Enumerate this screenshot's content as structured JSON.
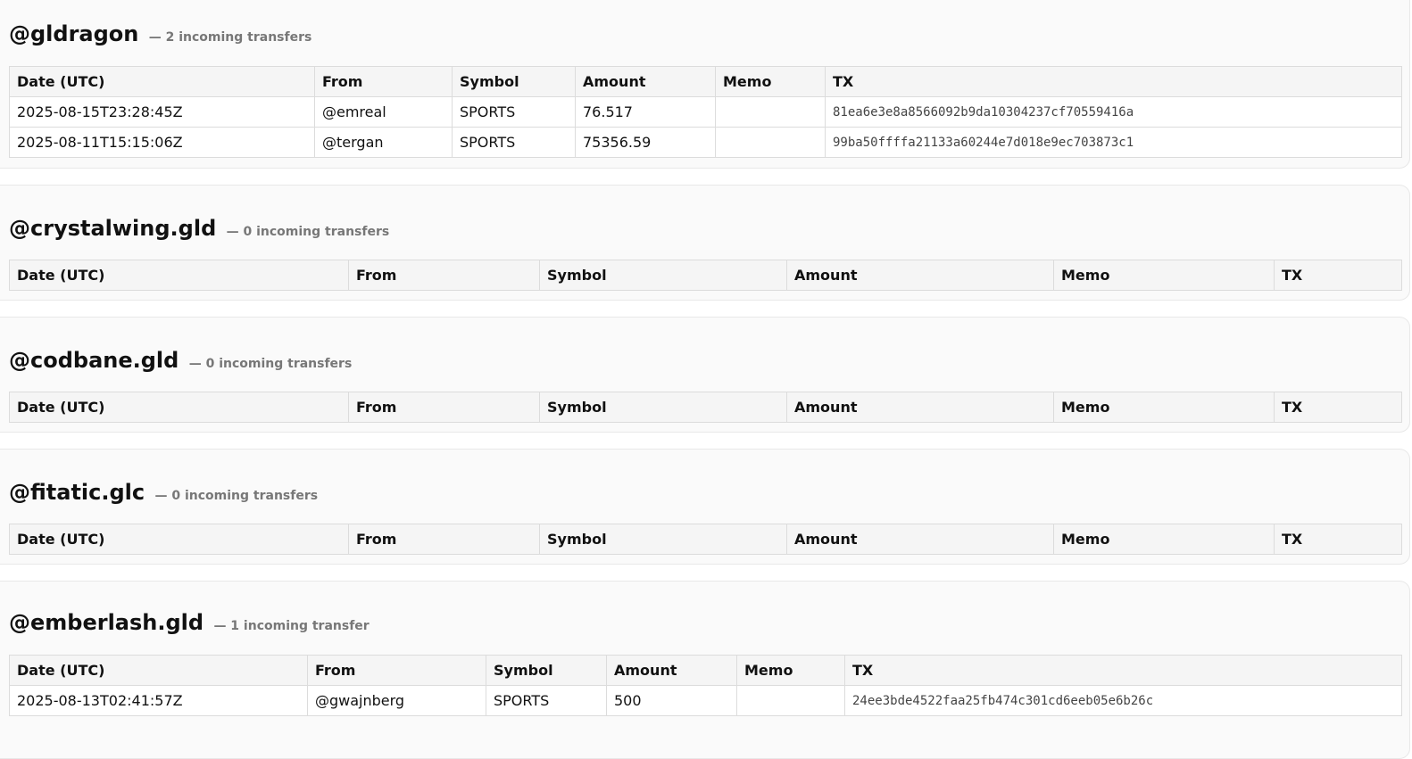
{
  "columns": [
    "Date (UTC)",
    "From",
    "Symbol",
    "Amount",
    "Memo",
    "TX"
  ],
  "accounts": [
    {
      "name": "@gldragon",
      "count_text": "— 2 incoming transfers",
      "rows": [
        {
          "date": "2025-08-15T23:28:45Z",
          "from": "@emreal",
          "symbol": "SPORTS",
          "amount": "76.517",
          "memo": "",
          "tx": "81ea6e3e8a8566092b9da10304237cf70559416a"
        },
        {
          "date": "2025-08-11T15:15:06Z",
          "from": "@tergan",
          "symbol": "SPORTS",
          "amount": "75356.59",
          "memo": "",
          "tx": "99ba50ffffa21133a60244e7d018e9ec703873c1"
        }
      ]
    },
    {
      "name": "@crystalwing.gld",
      "count_text": "— 0 incoming transfers",
      "rows": []
    },
    {
      "name": "@codbane.gld",
      "count_text": "— 0 incoming transfers",
      "rows": []
    },
    {
      "name": "@fitatic.glc",
      "count_text": "— 0 incoming transfers",
      "rows": []
    },
    {
      "name": "@emberlash.gld",
      "count_text": "— 1 incoming transfer",
      "rows": [
        {
          "date": "2025-08-13T02:41:57Z",
          "from": "@gwajnberg",
          "symbol": "SPORTS",
          "amount": "500",
          "memo": "",
          "tx": "24ee3bde4522faa25fb474c301cd6eeb05e6b26c"
        }
      ]
    }
  ]
}
